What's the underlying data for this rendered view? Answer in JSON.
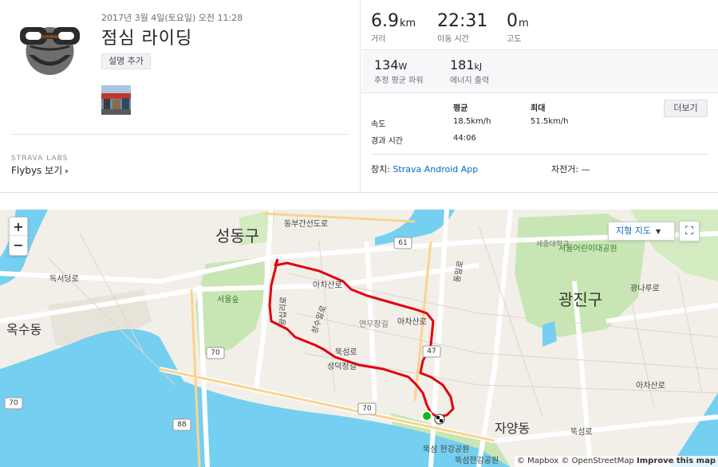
{
  "activity": {
    "date": "2017년 3월 4일(토요일) 오전 11:28",
    "title": "점심 라이딩",
    "add_description": "설명 추가",
    "labs_label": "STRAVA LABS",
    "flybys_label": "Flybys 보기"
  },
  "stats": {
    "distance": {
      "value": "6.9",
      "unit": "km",
      "label": "거리"
    },
    "moving_time": {
      "value": "22:31",
      "label": "이동 시간"
    },
    "elevation": {
      "value": "0",
      "unit": "m",
      "label": "고도"
    },
    "power": {
      "value": "134",
      "unit": "W",
      "label": "추정 평균 파워"
    },
    "energy": {
      "value": "181",
      "unit": "kJ",
      "label": "에너지 출력"
    }
  },
  "details": {
    "more_button": "더보기",
    "col_avg": "평균",
    "col_max": "최대",
    "speed_label": "속도",
    "speed_avg": "18.5km/h",
    "speed_max": "51.5km/h",
    "elapsed_label": "경과 시간",
    "elapsed_value": "44:06",
    "device_label": "장치:",
    "device_value": "Strava Android App",
    "bike_label": "자전거:",
    "bike_value": "—"
  },
  "map": {
    "zoom_in": "+",
    "zoom_out": "−",
    "map_type": "지형 지도",
    "fullscreen_icon": "⛶",
    "attribution_mapbox": "© Mapbox",
    "attribution_osm": "© OpenStreetMap",
    "attribution_improve": "Improve this map",
    "labels": {
      "seongdong": "성동구",
      "gwangjin": "광진구",
      "oksu": "옥수동",
      "jayang": "자양동",
      "seoul_forest": "서울숲",
      "childrens_park": "서울어린이대공원",
      "sejong_univ": "세종대학교",
      "achasan1": "아차산로",
      "achasan2": "아차산로",
      "achasan3": "아차산로",
      "ttukseom": "뚝섬로",
      "ttukseom2": "뚝섬로",
      "seongdeok": "성덕정길",
      "dongbu": "동부간선도로",
      "gwangnaru": "광나루로",
      "ttukseom_park": "뚝섬 한강공원",
      "ttukseom_park2": "뚝섬한강공원",
      "dokseo": "독서당로",
      "wangsimni": "왕십리로",
      "seongsu": "성수일로",
      "yeonmu": "연무장길",
      "dongil": "동일로",
      "r70a": "70",
      "r70b": "70",
      "r70c": "70",
      "r88": "88",
      "r61": "61",
      "r47": "47"
    }
  },
  "colors": {
    "route": "#e2000f",
    "start": "#14b814",
    "water": "#75cff0",
    "park": "#c8e6b4",
    "land": "#f2efe9",
    "link": "#0a66c2"
  }
}
